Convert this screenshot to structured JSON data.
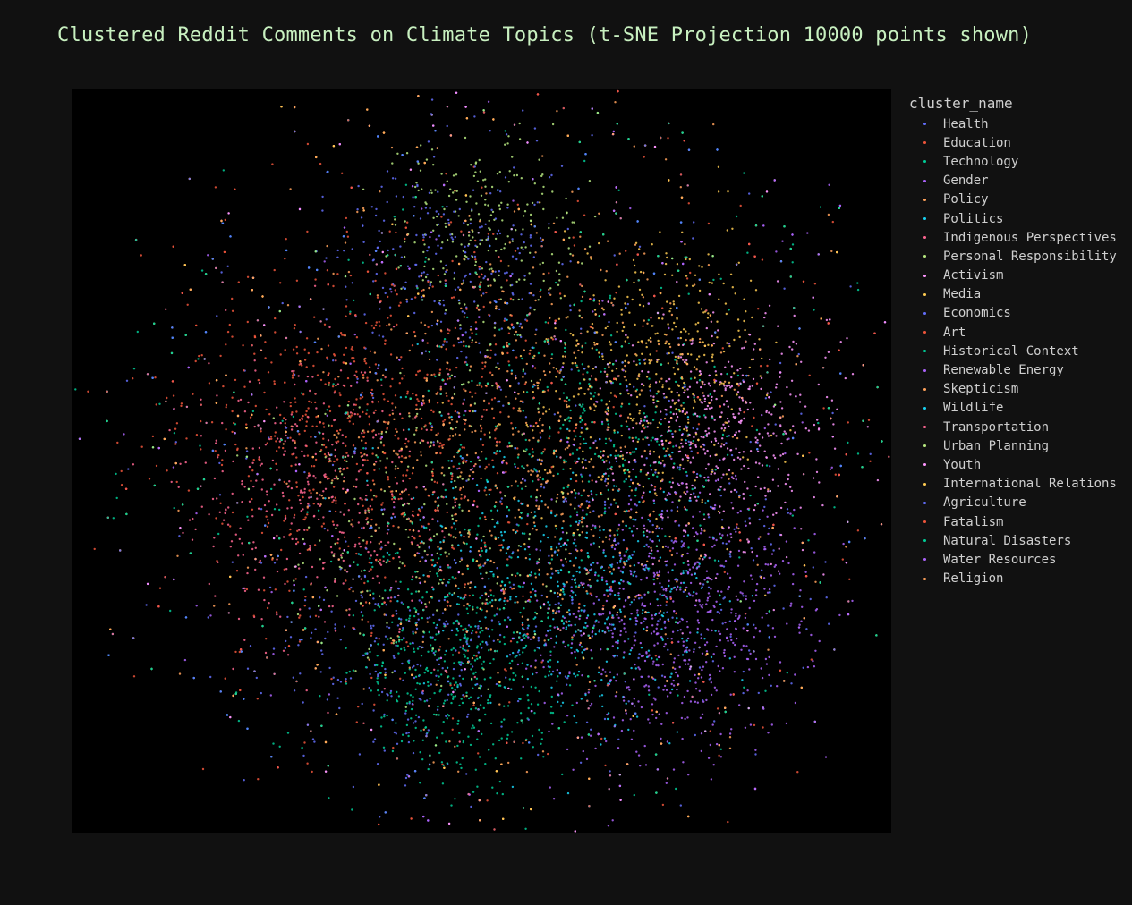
{
  "chart_data": {
    "type": "scatter",
    "title": "Clustered Reddit Comments on Climate Topics (t-SNE Projection 10000 points shown)",
    "xlabel": "",
    "ylabel": "",
    "background": "#000000",
    "paper_background": "#111111",
    "title_color": "#c8f0c0",
    "grid": false,
    "legend": {
      "title": "cluster_name",
      "placement": "right"
    },
    "points_shown": 10000,
    "series": [
      {
        "name": "Health",
        "color": "#636efa",
        "cx": 0.4,
        "cy": -0.25,
        "spread": 0.45
      },
      {
        "name": "Education",
        "color": "#ef553b",
        "cx": -0.55,
        "cy": 0.1,
        "spread": 0.35
      },
      {
        "name": "Technology",
        "color": "#00cc96",
        "cx": 0.3,
        "cy": 0.05,
        "spread": 0.3
      },
      {
        "name": "Gender",
        "color": "#ab63fa",
        "cx": 0.55,
        "cy": -0.4,
        "spread": 0.35
      },
      {
        "name": "Policy",
        "color": "#ffa15a",
        "cx": 0.0,
        "cy": 0.2,
        "spread": 0.5
      },
      {
        "name": "Politics",
        "color": "#19d3f3",
        "cx": 0.1,
        "cy": -0.3,
        "spread": 0.4
      },
      {
        "name": "Indigenous Perspectives",
        "color": "#ff6692",
        "cx": -0.6,
        "cy": -0.05,
        "spread": 0.3
      },
      {
        "name": "Personal Responsibility",
        "color": "#b6e880",
        "cx": -0.05,
        "cy": 0.7,
        "spread": 0.25
      },
      {
        "name": "Activism",
        "color": "#ff97ff",
        "cx": 0.65,
        "cy": 0.15,
        "spread": 0.25
      },
      {
        "name": "Media",
        "color": "#fecb52",
        "cx": 0.45,
        "cy": 0.35,
        "spread": 0.25
      },
      {
        "name": "Economics",
        "color": "#636efa",
        "cx": -0.15,
        "cy": 0.6,
        "spread": 0.3
      },
      {
        "name": "Art",
        "color": "#ef553b",
        "cx": -0.3,
        "cy": 0.25,
        "spread": 0.4
      },
      {
        "name": "Historical Context",
        "color": "#00cc96",
        "cx": -0.1,
        "cy": -0.65,
        "spread": 0.25
      },
      {
        "name": "Renewable Energy",
        "color": "#ab63fa",
        "cx": 0.4,
        "cy": -0.55,
        "spread": 0.3
      },
      {
        "name": "Skepticism",
        "color": "#ffa15a",
        "cx": 0.1,
        "cy": -0.1,
        "spread": 0.55
      },
      {
        "name": "Wildlife",
        "color": "#19d3f3",
        "cx": 0.25,
        "cy": -0.4,
        "spread": 0.35
      },
      {
        "name": "Transportation",
        "color": "#ff6692",
        "cx": -0.45,
        "cy": -0.2,
        "spread": 0.4
      },
      {
        "name": "Urban Planning",
        "color": "#b6e880",
        "cx": -0.2,
        "cy": -0.15,
        "spread": 0.4
      },
      {
        "name": "Youth",
        "color": "#ff97ff",
        "cx": 0.6,
        "cy": 0.0,
        "spread": 0.3
      },
      {
        "name": "International Relations",
        "color": "#fecb52",
        "cx": 0.35,
        "cy": 0.15,
        "spread": 0.4
      },
      {
        "name": "Agriculture",
        "color": "#636efa",
        "cx": -0.3,
        "cy": -0.55,
        "spread": 0.3
      },
      {
        "name": "Fatalism",
        "color": "#ef553b",
        "cx": -0.35,
        "cy": -0.05,
        "spread": 0.5
      },
      {
        "name": "Natural Disasters",
        "color": "#00cc96",
        "cx": -0.15,
        "cy": -0.5,
        "spread": 0.3
      },
      {
        "name": "Water Resources",
        "color": "#ab63fa",
        "cx": 0.5,
        "cy": -0.45,
        "spread": 0.4
      },
      {
        "name": "Religion",
        "color": "#ffa15a",
        "cx": 0.05,
        "cy": 0.0,
        "spread": 0.6
      }
    ]
  }
}
